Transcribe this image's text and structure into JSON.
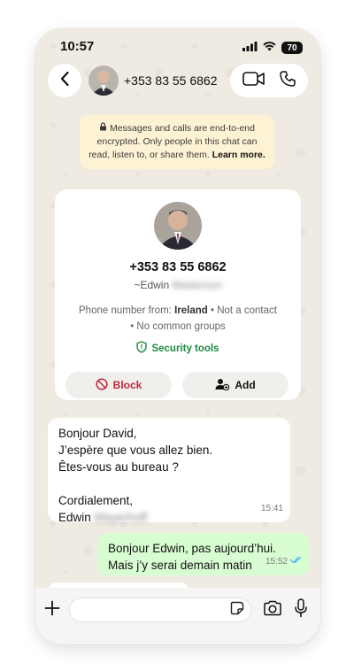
{
  "status_bar": {
    "time": "10:57",
    "battery": "70"
  },
  "header": {
    "phone": "+353 83 55 6862",
    "back_icon": "chevron-left-icon",
    "video_icon": "video-call-icon",
    "call_icon": "phone-icon"
  },
  "encryption_notice": {
    "text": "Messages and calls are end-to-end encrypted. Only people in this chat can read, listen to, or share them.",
    "link": "Learn more."
  },
  "contact_card": {
    "phone": "+353 83 55 6862",
    "name_prefix": "~Edwin",
    "name_blurred": "Masterson",
    "origin_label": "Phone number from:",
    "origin_country": "Ireland",
    "origin_suffix": "• Not a contact",
    "groups": "• No common groups",
    "security_label": "Security tools",
    "block_label": "Block",
    "add_label": "Add"
  },
  "messages": {
    "incoming": {
      "lines": [
        "Bonjour David,",
        "J’espère que vous allez bien.",
        "Êtes-vous au bureau ?",
        "",
        "Cordialement,"
      ],
      "signature": "Edwin",
      "signature_blurred": "Mayerhoff",
      "time": "15:41"
    },
    "outgoing": {
      "lines": [
        "Bonjour Edwin, pas aujourd’hui.",
        "Mais j’y serai demain matin"
      ],
      "time": "15:52",
      "read_color": "#53bdeb"
    }
  },
  "input_bar": {
    "placeholder": "",
    "value": ""
  },
  "colors": {
    "wallpaper": "#efeae2",
    "notice_bg": "#fdf3d4",
    "outgoing_bubble": "#d9fdd3",
    "block_red": "#c0263c",
    "security_green": "#1b8a3e"
  }
}
